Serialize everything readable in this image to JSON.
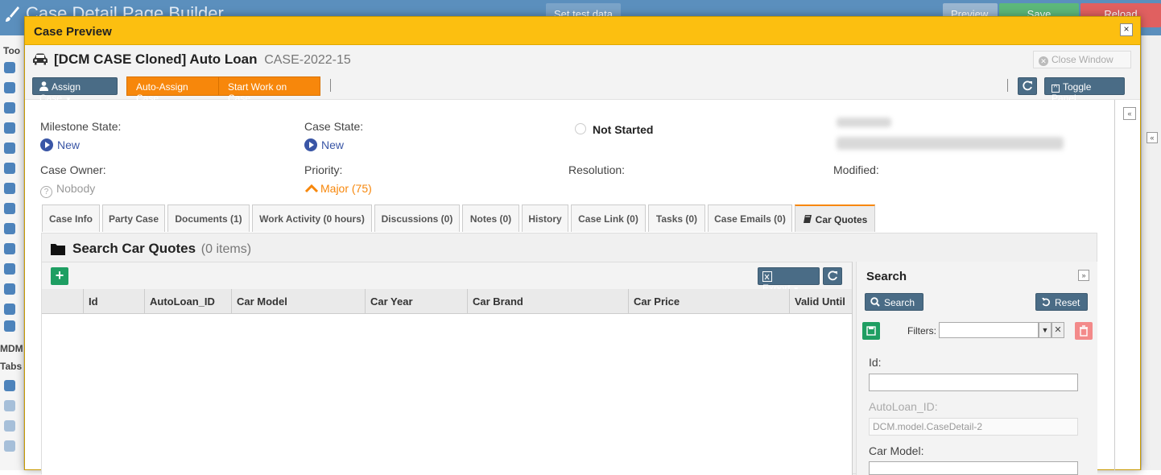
{
  "background": {
    "title": "Case Detail Page Builder",
    "set_test_data": "Set test data",
    "preview": "Preview",
    "save": "Save",
    "reload": "Reload",
    "sidebar_labels": [
      "Too",
      "MDM",
      "Tabs"
    ]
  },
  "modal": {
    "title": "Case Preview",
    "close_glyph": "×"
  },
  "case": {
    "title": "[DCM CASE Cloned] Auto Loan",
    "number": "CASE-2022-15",
    "close_window": "Close Window"
  },
  "toolbar": {
    "assign_case": "Assign Case",
    "auto_assign": "Auto-Assign Case",
    "start_work": "Start Work on Case",
    "toggle_panel": "Toggle Panel"
  },
  "fields": {
    "milestone_state_label": "Milestone State:",
    "milestone_state_value": "New",
    "case_state_label": "Case State:",
    "case_state_value": "New",
    "status": "Not Started",
    "case_owner_label": "Case Owner:",
    "case_owner_value": "Nobody",
    "priority_label": "Priority:",
    "priority_value": "Major (75)",
    "resolution_label": "Resolution:",
    "modified_label": "Modified:"
  },
  "tabs": [
    "Case Info",
    "Party Case",
    "Documents (1)",
    "Work Activity (0 hours)",
    "Discussions (0)",
    "Notes (0)",
    "History",
    "Case Link (0)",
    "Tasks (0)",
    "Case Emails (0)",
    "Car Quotes"
  ],
  "panel": {
    "title": "Search Car Quotes",
    "count": "(0 items)",
    "export": "Export"
  },
  "grid": {
    "columns": [
      "Id",
      "AutoLoan_ID",
      "Car Model",
      "Car Year",
      "Car Brand",
      "Car Price",
      "Valid Until"
    ]
  },
  "search": {
    "title": "Search",
    "search_btn": "Search",
    "reset_btn": "Reset",
    "filters_label": "Filters:",
    "id_label": "Id:",
    "autoloan_label": "AutoLoan_ID:",
    "autoloan_value": "DCM.model.CaseDetail-2",
    "car_model_label": "Car Model:"
  },
  "colors": {
    "header": "#fcbf10",
    "accent_orange": "#f7870b",
    "button_blue": "#4a6c86",
    "link_blue": "#3a56a6",
    "add_green": "#1e9e62"
  }
}
